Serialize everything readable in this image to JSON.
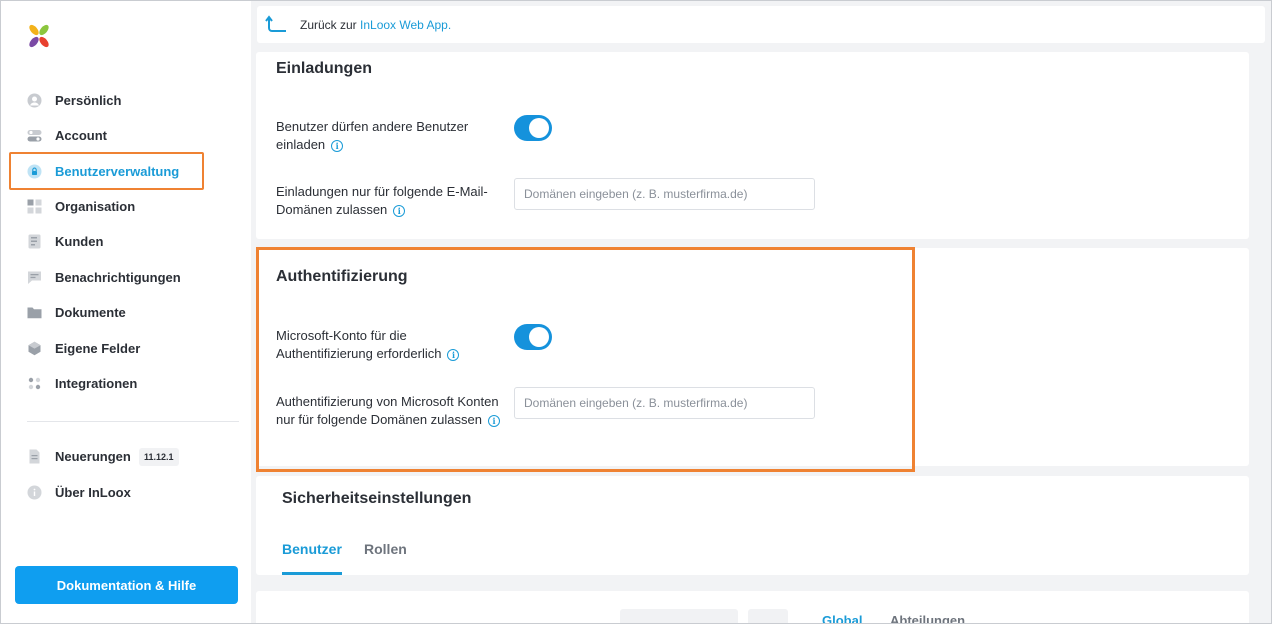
{
  "sidebar": {
    "items": [
      {
        "label": "Persönlich",
        "icon": "user-circle-icon"
      },
      {
        "label": "Account",
        "icon": "toggle-icon"
      },
      {
        "label": "Benutzerverwaltung",
        "icon": "lock-icon",
        "active": true
      },
      {
        "label": "Organisation",
        "icon": "grid-icon"
      },
      {
        "label": "Kunden",
        "icon": "contacts-icon"
      },
      {
        "label": "Benachrichtigungen",
        "icon": "chat-icon"
      },
      {
        "label": "Dokumente",
        "icon": "folder-icon"
      },
      {
        "label": "Eigene Felder",
        "icon": "hexagon-icon"
      },
      {
        "label": "Integrationen",
        "icon": "plug-icon"
      }
    ],
    "bottom_items": [
      {
        "label": "Neuerungen",
        "icon": "document-icon",
        "badge": "11.12.1"
      },
      {
        "label": "Über InLoox",
        "icon": "info-circle-icon"
      }
    ],
    "doc_button": "Dokumentation & Hilfe"
  },
  "backbar": {
    "prefix": "Zurück zur ",
    "link": "InLoox Web App."
  },
  "invitations": {
    "title": "Einladungen",
    "allow_invite_label": "Benutzer dürfen andere Benutzer einladen",
    "allow_invite_on": true,
    "domains_label": "Einladungen nur für folgende E-Mail-Domänen zulassen",
    "domains_placeholder": "Domänen eingeben (z. B. musterfirma.de)",
    "domains_value": ""
  },
  "authentication": {
    "title": "Authentifizierung",
    "ms_required_label": "Microsoft-Konto für die Authentifizierung erforderlich",
    "ms_required_on": true,
    "ms_domains_label": "Authentifizierung von Microsoft Konten nur für folgende Domänen zulassen",
    "ms_domains_placeholder": "Domänen eingeben (z. B. musterfirma.de)",
    "ms_domains_value": ""
  },
  "security": {
    "title": "Sicherheitseinstellungen",
    "tabs": [
      {
        "label": "Benutzer",
        "active": true
      },
      {
        "label": "Rollen",
        "active": false
      }
    ]
  },
  "bottom_card": {
    "fragments": [
      "Global",
      "Abteilungen"
    ]
  },
  "colors": {
    "accent": "#1a9bd7",
    "highlight": "#ef8232",
    "button": "#0f9ef0"
  }
}
